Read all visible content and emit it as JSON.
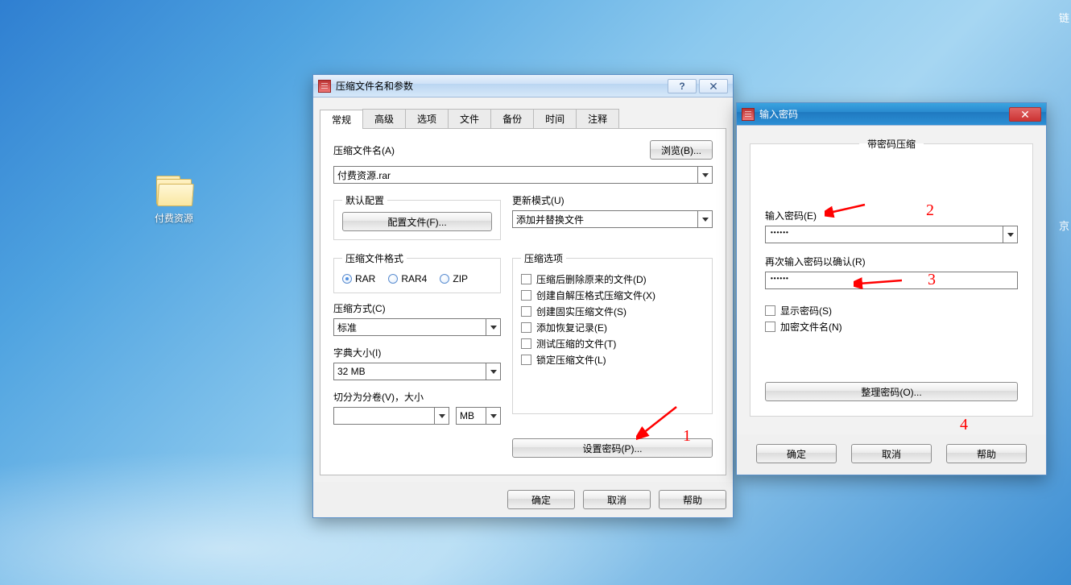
{
  "desktop": {
    "folder_label": "付费资源"
  },
  "main": {
    "title": "压缩文件名和参数",
    "tabs": [
      "常规",
      "高级",
      "选项",
      "文件",
      "备份",
      "时间",
      "注释"
    ],
    "archive_name_label": "压缩文件名(A)",
    "browse_button": "浏览(B)...",
    "archive_name_value": "付费资源.rar",
    "default_profile_legend": "默认配置",
    "profiles_button": "配置文件(F)...",
    "update_mode_label": "更新模式(U)",
    "update_mode_value": "添加并替换文件",
    "format_legend": "压缩文件格式",
    "formats": {
      "rar": "RAR",
      "rar4": "RAR4",
      "zip": "ZIP"
    },
    "method_label": "压缩方式(C)",
    "method_value": "标准",
    "dict_label": "字典大小(I)",
    "dict_value": "32 MB",
    "volume_label": "切分为分卷(V)，大小",
    "volume_unit": "MB",
    "options_legend": "压缩选项",
    "opt1": "压缩后删除原来的文件(D)",
    "opt2": "创建自解压格式压缩文件(X)",
    "opt3": "创建固实压缩文件(S)",
    "opt4": "添加恢复记录(E)",
    "opt5": "测试压缩的文件(T)",
    "opt6": "锁定压缩文件(L)",
    "set_password_button": "设置密码(P)...",
    "ok": "确定",
    "cancel": "取消",
    "help": "帮助"
  },
  "pwd": {
    "title": "输入密码",
    "legend": "带密码压缩",
    "enter_label": "输入密码(E)",
    "reenter_label": "再次输入密码以确认(R)",
    "show_password": "显示密码(S)",
    "encrypt_filenames": "加密文件名(N)",
    "organize_button": "整理密码(O)...",
    "ok": "确定",
    "cancel": "取消",
    "help": "帮助",
    "pwd_value": "••••••",
    "pwd_confirm_value": "••••••"
  },
  "annotations": {
    "n1": "1",
    "n2": "2",
    "n3": "3",
    "n4": "4"
  },
  "edge_text": {
    "top": "链",
    "mid": "京"
  }
}
